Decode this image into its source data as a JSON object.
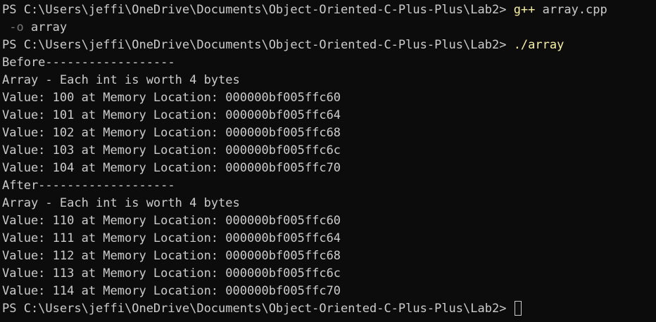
{
  "window": {
    "background": "#0c0c0c",
    "text_color": "#cccccc",
    "command_color": "#f9f1a5",
    "flag_color": "#767676"
  },
  "session": {
    "prompt": "PS C:\\Users\\jeffi\\OneDrive\\Documents\\Object-Oriented-C-Plus-Plus\\Lab2> ",
    "compile": {
      "command": "g++",
      "arg_file": " array.cpp",
      "flag": " -o",
      "arg_out": " array"
    },
    "run_command": "./array",
    "output": {
      "before_header": "Before------------------",
      "after_header": "After-------------------",
      "array_note": "Array - Each int is worth 4 bytes",
      "before_values": [
        "Value: 100 at Memory Location: 000000bf005ffc60",
        "Value: 101 at Memory Location: 000000bf005ffc64",
        "Value: 102 at Memory Location: 000000bf005ffc68",
        "Value: 103 at Memory Location: 000000bf005ffc6c",
        "Value: 104 at Memory Location: 000000bf005ffc70"
      ],
      "after_values": [
        "Value: 110 at Memory Location: 000000bf005ffc60",
        "Value: 111 at Memory Location: 000000bf005ffc64",
        "Value: 112 at Memory Location: 000000bf005ffc68",
        "Value: 113 at Memory Location: 000000bf005ffc6c",
        "Value: 114 at Memory Location: 000000bf005ffc70"
      ]
    }
  }
}
